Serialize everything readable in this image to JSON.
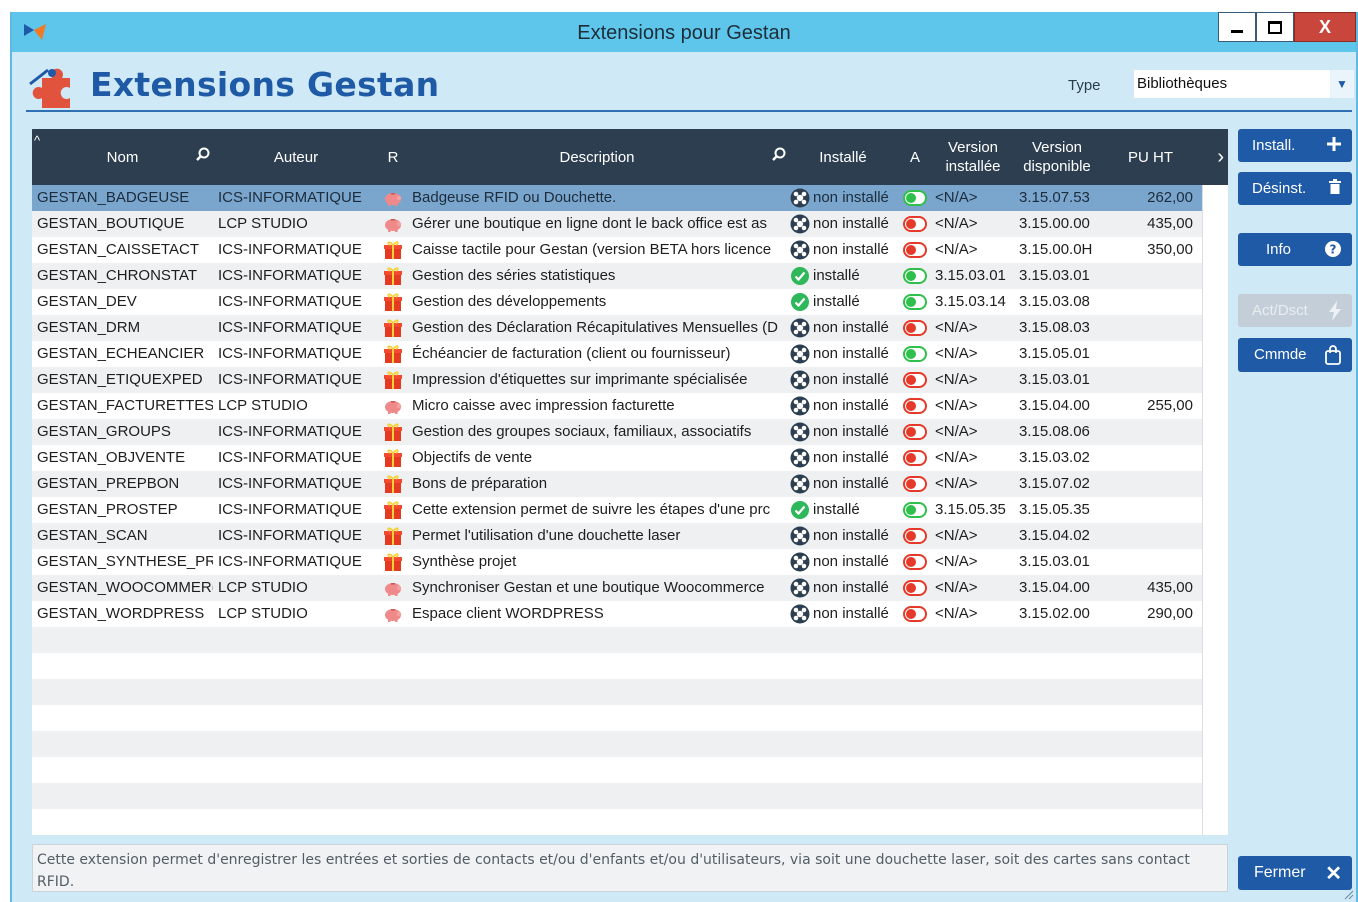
{
  "window": {
    "title": "Extensions pour Gestan",
    "close_symbol": "X"
  },
  "header": {
    "title": "Extensions Gestan",
    "type_label": "Type",
    "type_value": "Bibliothèques"
  },
  "columns": {
    "nom": "Nom",
    "auteur": "Auteur",
    "r": "R",
    "description": "Description",
    "installe": "Installé",
    "a": "A",
    "version_installee": "Version installée",
    "version_disponible": "Version disponible",
    "pu_ht": "PU HT"
  },
  "rows": [
    {
      "nom": "GESTAN_BADGEUSE",
      "auteur": "ICS-INFORMATIQUE",
      "r_icon": "piggy-bank-icon",
      "description": "Badgeuse RFID ou Douchette.",
      "status": "non installé",
      "installed": false,
      "active": true,
      "v_inst": "<N/A>",
      "v_disp": "3.15.07.53",
      "pu": "262,00",
      "selected": true
    },
    {
      "nom": "GESTAN_BOUTIQUE",
      "auteur": "LCP STUDIO",
      "r_icon": "piggy-bank-icon",
      "description": "Gérer une boutique en ligne dont le back office est as",
      "status": "non installé",
      "installed": false,
      "active": false,
      "v_inst": "<N/A>",
      "v_disp": "3.15.00.00",
      "pu": "435,00"
    },
    {
      "nom": "GESTAN_CAISSETACT",
      "auteur": "ICS-INFORMATIQUE",
      "r_icon": "gift-icon",
      "description": "Caisse tactile pour Gestan (version BETA hors licence",
      "status": "non installé",
      "installed": false,
      "active": false,
      "v_inst": "<N/A>",
      "v_disp": "3.15.00.0H",
      "pu": "350,00"
    },
    {
      "nom": "GESTAN_CHRONSTAT",
      "auteur": "ICS-INFORMATIQUE",
      "r_icon": "gift-icon",
      "description": "Gestion des séries statistiques",
      "status": "installé",
      "installed": true,
      "active": true,
      "v_inst": "3.15.03.01",
      "v_disp": "3.15.03.01",
      "pu": ""
    },
    {
      "nom": "GESTAN_DEV",
      "auteur": "ICS-INFORMATIQUE",
      "r_icon": "gift-icon",
      "description": "Gestion des développements",
      "status": "installé",
      "installed": true,
      "active": true,
      "v_inst": "3.15.03.14",
      "v_disp": "3.15.03.08",
      "pu": ""
    },
    {
      "nom": "GESTAN_DRM",
      "auteur": "ICS-INFORMATIQUE",
      "r_icon": "gift-icon",
      "description": "Gestion des Déclaration Récapitulatives Mensuelles (D",
      "status": "non installé",
      "installed": false,
      "active": false,
      "v_inst": "<N/A>",
      "v_disp": "3.15.08.03",
      "pu": ""
    },
    {
      "nom": "GESTAN_ECHEANCIER",
      "auteur": "ICS-INFORMATIQUE",
      "r_icon": "gift-icon",
      "description": "Échéancier de facturation (client ou fournisseur)",
      "status": "non installé",
      "installed": false,
      "active": true,
      "v_inst": "<N/A>",
      "v_disp": "3.15.05.01",
      "pu": ""
    },
    {
      "nom": "GESTAN_ETIQUEXPED",
      "auteur": "ICS-INFORMATIQUE",
      "r_icon": "gift-icon",
      "description": "Impression d'étiquettes sur imprimante spécialisée",
      "status": "non installé",
      "installed": false,
      "active": false,
      "v_inst": "<N/A>",
      "v_disp": "3.15.03.01",
      "pu": ""
    },
    {
      "nom": "GESTAN_FACTURETTES",
      "auteur": "LCP STUDIO",
      "r_icon": "piggy-bank-icon",
      "description": "Micro caisse avec impression facturette",
      "status": "non installé",
      "installed": false,
      "active": false,
      "v_inst": "<N/A>",
      "v_disp": "3.15.04.00",
      "pu": "255,00"
    },
    {
      "nom": "GESTAN_GROUPS",
      "auteur": "ICS-INFORMATIQUE",
      "r_icon": "gift-icon",
      "description": "Gestion des groupes sociaux, familiaux, associatifs",
      "status": "non installé",
      "installed": false,
      "active": false,
      "v_inst": "<N/A>",
      "v_disp": "3.15.08.06",
      "pu": ""
    },
    {
      "nom": "GESTAN_OBJVENTE",
      "auteur": "ICS-INFORMATIQUE",
      "r_icon": "gift-icon",
      "description": "Objectifs de vente",
      "status": "non installé",
      "installed": false,
      "active": false,
      "v_inst": "<N/A>",
      "v_disp": "3.15.03.02",
      "pu": ""
    },
    {
      "nom": "GESTAN_PREPBON",
      "auteur": "ICS-INFORMATIQUE",
      "r_icon": "gift-icon",
      "description": "Bons de préparation",
      "status": "non installé",
      "installed": false,
      "active": false,
      "v_inst": "<N/A>",
      "v_disp": "3.15.07.02",
      "pu": ""
    },
    {
      "nom": "GESTAN_PROSTEP",
      "auteur": "ICS-INFORMATIQUE",
      "r_icon": "gift-icon",
      "description": "Cette extension permet de suivre les étapes d'une prc",
      "status": "installé",
      "installed": true,
      "active": true,
      "v_inst": "3.15.05.35",
      "v_disp": "3.15.05.35",
      "pu": ""
    },
    {
      "nom": "GESTAN_SCAN",
      "auteur": "ICS-INFORMATIQUE",
      "r_icon": "gift-icon",
      "description": "Permet l'utilisation d'une douchette laser",
      "status": "non installé",
      "installed": false,
      "active": false,
      "v_inst": "<N/A>",
      "v_disp": "3.15.04.02",
      "pu": ""
    },
    {
      "nom": "GESTAN_SYNTHESE_PR",
      "auteur": "ICS-INFORMATIQUE",
      "r_icon": "gift-icon",
      "description": "Synthèse projet",
      "status": "non installé",
      "installed": false,
      "active": false,
      "v_inst": "<N/A>",
      "v_disp": "3.15.03.01",
      "pu": ""
    },
    {
      "nom": "GESTAN_WOOCOMMER(",
      "auteur": "LCP STUDIO",
      "r_icon": "piggy-bank-icon",
      "description": "Synchroniser Gestan et une boutique Woocommerce",
      "status": "non installé",
      "installed": false,
      "active": false,
      "v_inst": "<N/A>",
      "v_disp": "3.15.04.00",
      "pu": "435,00"
    },
    {
      "nom": "GESTAN_WORDPRESS",
      "auteur": "LCP STUDIO",
      "r_icon": "piggy-bank-icon",
      "description": "Espace client WORDPRESS",
      "status": "non installé",
      "installed": false,
      "active": false,
      "v_inst": "<N/A>",
      "v_disp": "3.15.02.00",
      "pu": "290,00"
    }
  ],
  "sidebar": {
    "install": "Install.",
    "uninstall": "Désinst.",
    "info": "Info",
    "actdsct": "Act/Dsct",
    "cmmde": "Cmmde"
  },
  "footer": {
    "description": "Cette extension permet d'enregistrer les entrées et sorties de contacts et/ou d'enfants et/ou d'utilisateurs, via soit une douchette laser, soit des cartes sans contact RFID.",
    "close": "Fermer"
  },
  "colors": {
    "accent": "#1f5aa6",
    "titlebar": "#5ec6ea",
    "header_row": "#2c3e4f",
    "selected_row": "#7aa6cd",
    "toggle_on": "#2ec04a",
    "toggle_off": "#e53a2a",
    "installed_check": "#2fb85b"
  }
}
